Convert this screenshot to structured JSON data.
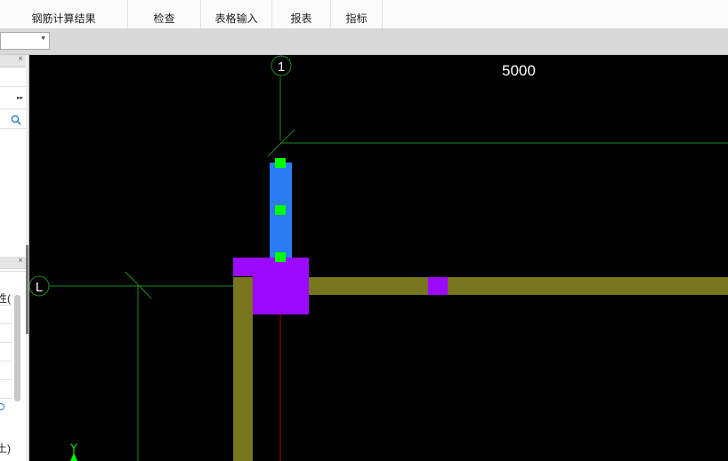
{
  "ribbon": {
    "tabs": [
      {
        "label": "钢筋计算结果"
      },
      {
        "label": "检查"
      },
      {
        "label": "表格输入"
      },
      {
        "label": "报表"
      },
      {
        "label": "指标"
      }
    ]
  },
  "toolbar": {
    "combo_value": ""
  },
  "left_panel": {
    "close_glyph": "×",
    "expand_glyph": "▸▸",
    "property_header_fragment": "性(",
    "concrete_fragment": "土)"
  },
  "canvas": {
    "dimension_label": "5000",
    "axis_labels": {
      "vertical_axis": "1",
      "horizontal_axis": "L",
      "ucs_y": "Y"
    },
    "colors": {
      "background": "#000000",
      "grid_line": "#1f8c1f",
      "beam": "#77751d",
      "column": "#9b09ff",
      "selected_member": "#2b7bf2",
      "grip": "#00ff00",
      "red_axis": "#c80000"
    }
  }
}
